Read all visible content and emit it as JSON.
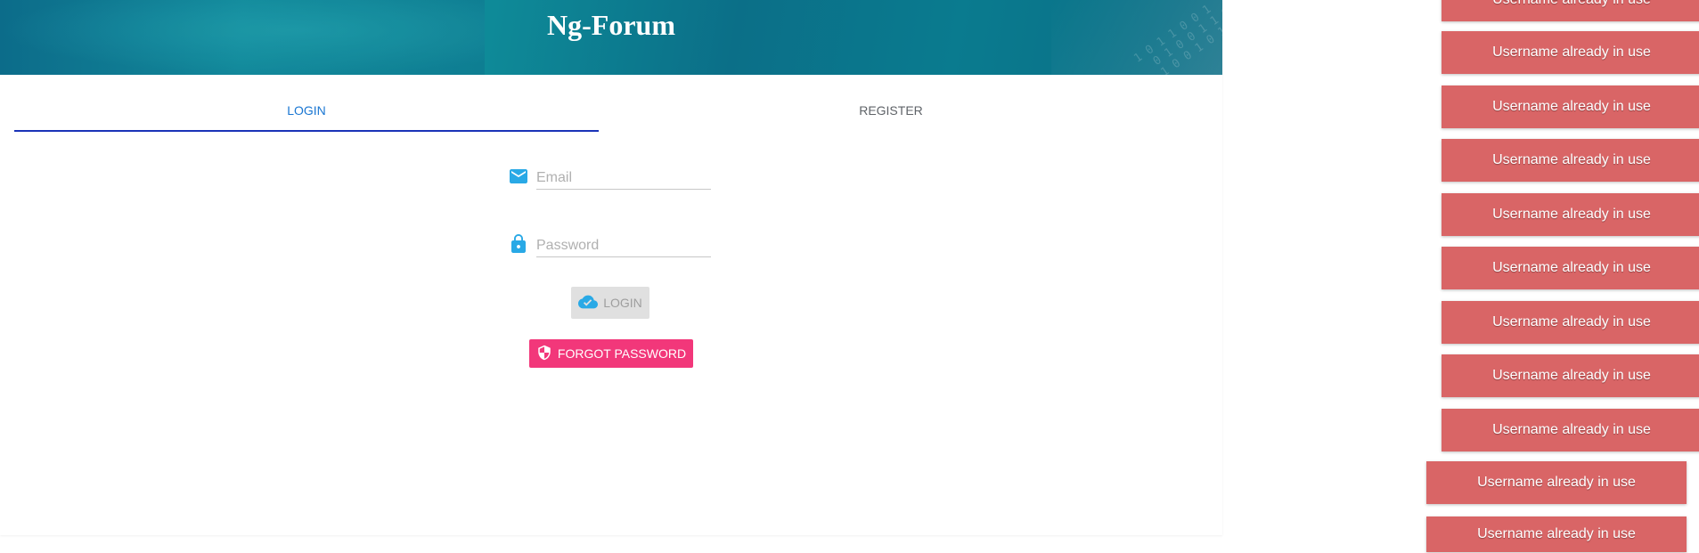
{
  "header": {
    "title": "Ng-Forum"
  },
  "tabs": [
    {
      "label": "LOGIN",
      "active": true
    },
    {
      "label": "REGISTER",
      "active": false
    }
  ],
  "form": {
    "email": {
      "placeholder": "Email",
      "value": "",
      "icon": "email-icon"
    },
    "password": {
      "placeholder": "Password",
      "value": "",
      "icon": "lock-icon"
    },
    "login_button": {
      "label": "LOGIN",
      "icon": "cloud-check-icon"
    },
    "forgot_button": {
      "label": "FORGOT PASSWORD",
      "icon": "shield-icon"
    }
  },
  "toasts": [
    {
      "message": "Username already in use"
    },
    {
      "message": "Username already in use"
    },
    {
      "message": "Username already in use"
    },
    {
      "message": "Username already in use"
    },
    {
      "message": "Username already in use"
    },
    {
      "message": "Username already in use"
    },
    {
      "message": "Username already in use"
    },
    {
      "message": "Username already in use"
    },
    {
      "message": "Username already in use"
    },
    {
      "message": "Username already in use"
    },
    {
      "message": "Username already in use"
    }
  ],
  "colors": {
    "accent": "#1976d2",
    "tab_ink": "#1a33b8",
    "icon": "#29a9e6",
    "forgot_button": "#f2377a",
    "toast": "#d96566"
  }
}
